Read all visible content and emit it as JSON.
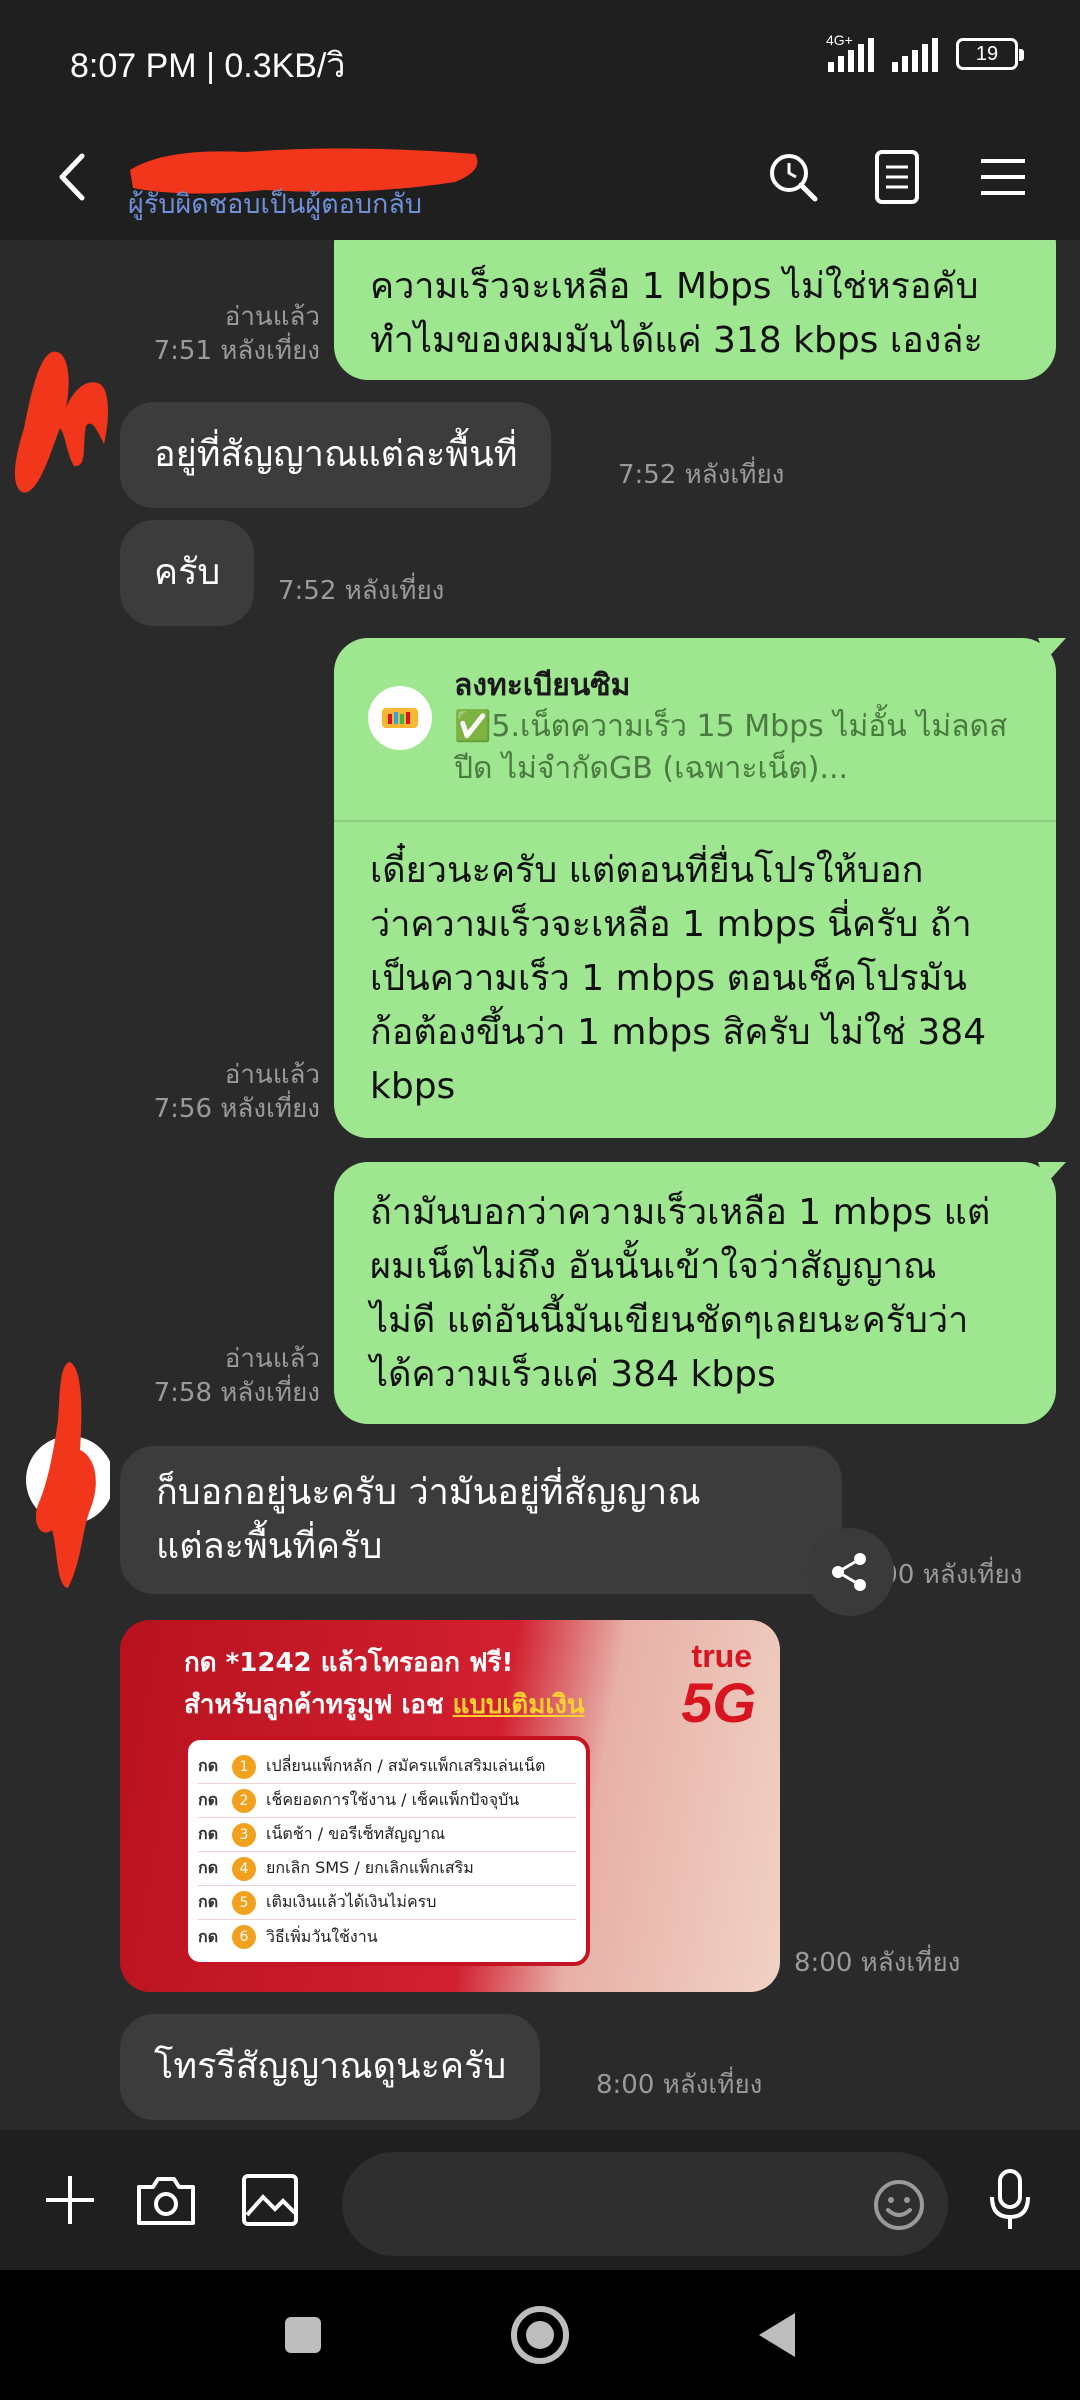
{
  "status_bar": {
    "time": "8:07 PM | 0.3KB/วิ",
    "network_label": "4G+",
    "battery": "19"
  },
  "header": {
    "subtitle": "ผู้รับผิดชอบเป็นผู้ตอบกลับ"
  },
  "messages": [
    {
      "id": "m1",
      "side": "out",
      "lines": [
        "ความเร็วจะเหลือ 1 Mbps ไม่ใช่หรอคับ",
        "ทำไมของผมมันได้แค่ 318 kbps เองล่ะ"
      ],
      "read": "อ่านแล้ว",
      "time": "7:51 หลังเที่ยง"
    },
    {
      "id": "m2",
      "side": "in",
      "text": "อยู่ที่สัญญาณแต่ละพื้นที่",
      "time": "7:52 หลังเที่ยง"
    },
    {
      "id": "m3",
      "side": "in",
      "text": "ครับ",
      "time": "7:52 หลังเที่ยง"
    },
    {
      "id": "m4",
      "side": "out",
      "quote_title": "ลงทะเบียนซิม",
      "quote_lines": [
        "✅5.เน็ตความเร็ว 15 Mbps ไม่อั้น ไม่ลดส",
        "ปีด ไม่จำกัดGB (เฉพาะเน็ต)..."
      ],
      "lines": [
        "เดี๋ยวนะครับ แต่ตอนที่ยื่นโปรให้บอก",
        "ว่าความเร็วจะเหลือ 1 mbps นี่ครับ ถ้า",
        "เป็นความเร็ว 1 mbps ตอนเช็คโปรมัน",
        "ก้อต้องขึ้นว่า 1 mbps สิครับ ไม่ใช่ 384",
        "kbps"
      ],
      "read": "อ่านแล้ว",
      "time": "7:56 หลังเที่ยง"
    },
    {
      "id": "m5",
      "side": "out",
      "lines": [
        "ถ้ามันบอกว่าความเร็วเหลือ 1 mbps แต่",
        "ผมเน็ตไม่ถึง อันนั้นเข้าใจว่าสัญญาณ",
        "ไม่ดี แต่อันนี้มันเขียนชัดๆเลยนะครับว่า",
        "ได้ความเร็วแค่ 384 kbps"
      ],
      "read": "อ่านแล้ว",
      "time": "7:58 หลังเที่ยง"
    },
    {
      "id": "m6",
      "side": "in",
      "lines": [
        "ก็บอกอยู่นะครับ ว่ามันอยู่ที่สัญญาณ",
        "แต่ละพื้นที่ครับ"
      ],
      "time": "8:00 หลังเที่ยง"
    },
    {
      "id": "m7",
      "side": "in",
      "type": "image",
      "time": "8:00 หลังเที่ยง",
      "image": {
        "line1": "กด *1242 แล้วโทรออก ฟรี!",
        "line2_prefix": "สำหรับลูกค้าทรูมูฟ เอช ",
        "line2_highlight": "แบบเติมเงิน",
        "brand_top": "true",
        "brand_bottom": "5G",
        "rows": [
          {
            "key": "กด",
            "num": "1",
            "text": "เปลี่ยนแพ็กหลัก / สมัครแพ็กเสริมเล่นเน็ต"
          },
          {
            "key": "กด",
            "num": "2",
            "text": "เช็คยอดการใช้งาน / เช็คแพ็กปัจจุบัน"
          },
          {
            "key": "กด",
            "num": "3",
            "text": "เน็ตช้า / ขอรีเซ็ทสัญญาณ"
          },
          {
            "key": "กด",
            "num": "4",
            "text": "ยกเลิก SMS / ยกเลิกแพ็กเสริม"
          },
          {
            "key": "กด",
            "num": "5",
            "text": "เติมเงินแล้วได้เงินไม่ครบ"
          },
          {
            "key": "กด",
            "num": "6",
            "text": "วิธีเพิ่มวันใช้งาน"
          }
        ]
      }
    },
    {
      "id": "m8",
      "side": "in",
      "text": "โทรรีสัญญาณดูนะครับ",
      "time": "8:00 หลังเที่ยง"
    }
  ],
  "icons": {
    "back": "chevron-left-icon",
    "search": "search-icon",
    "notes": "notes-icon",
    "menu": "menu-icon",
    "plus": "plus-icon",
    "camera": "camera-icon",
    "gallery": "image-icon",
    "emoji": "emoji-icon",
    "mic": "mic-icon",
    "share": "share-icon"
  },
  "colors": {
    "background": "#2a2a2a",
    "bar": "#1f1f1f",
    "outgoing_bubble": "#9ee68f",
    "incoming_bubble": "#3c3c3c",
    "subtitle": "#6f8fd6",
    "redaction": "#f2361c"
  }
}
